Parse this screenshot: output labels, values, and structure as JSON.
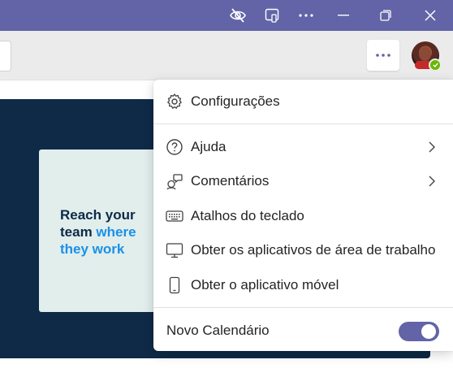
{
  "titlebar": {
    "buttons": [
      "eye-off-icon",
      "screen-share-icon",
      "more-horizontal-icon",
      "minimize-icon",
      "restore-icon",
      "close-icon"
    ]
  },
  "colors": {
    "titlebar": "#6264a7",
    "accent": "#6264a7",
    "banner": "#0e2a47",
    "card": "#e1eeec",
    "highlight": "#1a90e8",
    "presence": "#6bb700"
  },
  "banner": {
    "line1": "Reach your",
    "line2_a": "team ",
    "line2_b": "where",
    "line3": "they work"
  },
  "menu": {
    "settings": "Configurações",
    "help": "Ajuda",
    "feedback": "Comentários",
    "shortcuts": "Atalhos do teclado",
    "desktop_apps": "Obter os aplicativos de área de trabalho",
    "mobile_app": "Obter o aplicativo móvel",
    "new_calendar": "Novo Calendário",
    "new_calendar_on": true
  }
}
